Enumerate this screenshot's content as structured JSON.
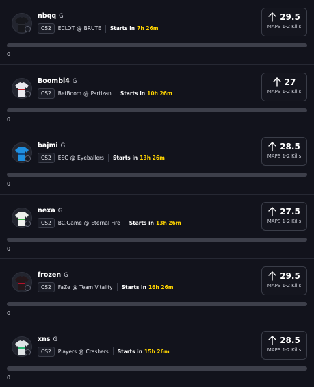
{
  "picks": [
    {
      "player": "nbqq",
      "position": "G",
      "game": "CS2",
      "team": "ECLOT",
      "opponent": "BRUTE",
      "vs": "@",
      "starts_label": "Starts in",
      "starts_time": "7h 26m",
      "line": "29.5",
      "stat": "MAPS 1-2 Kills",
      "progress_value": "0",
      "progress_fraction": 0,
      "jersey_color": "#17181d",
      "jersey_accent": "#2a2c33"
    },
    {
      "player": "Boombl4",
      "position": "G",
      "game": "CS2",
      "team": "BetBoom",
      "opponent": "Partizan",
      "vs": "@",
      "starts_label": "Starts in",
      "starts_time": "10h 26m",
      "line": "27",
      "stat": "MAPS 1-2 Kills",
      "progress_value": "0",
      "progress_fraction": 0,
      "jersey_color": "#e9e9ee",
      "jersey_accent": "#c4242c"
    },
    {
      "player": "bajmi",
      "position": "G",
      "game": "CS2",
      "team": "ESC",
      "opponent": "Eyeballers",
      "vs": "@",
      "starts_label": "Starts in",
      "starts_time": "13h 26m",
      "line": "28.5",
      "stat": "MAPS 1-2 Kills",
      "progress_value": "0",
      "progress_fraction": 0,
      "jersey_color": "#1f8fe0",
      "jersey_accent": "#0e4d8c"
    },
    {
      "player": "nexa",
      "position": "G",
      "game": "CS2",
      "team": "BC.Game",
      "opponent": "Eternal Fire",
      "vs": "@",
      "starts_label": "Starts in",
      "starts_time": "13h 26m",
      "line": "27.5",
      "stat": "MAPS 1-2 Kills",
      "progress_value": "0",
      "progress_fraction": 0,
      "jersey_color": "#eef0ec",
      "jersey_accent": "#3bb54a"
    },
    {
      "player": "frozen",
      "position": "G",
      "game": "CS2",
      "team": "FaZe",
      "opponent": "Team Vitality",
      "vs": "@",
      "starts_label": "Starts in",
      "starts_time": "16h 26m",
      "line": "29.5",
      "stat": "MAPS 1-2 Kills",
      "progress_value": "0",
      "progress_fraction": 0,
      "jersey_color": "#25171b",
      "jersey_accent": "#b3122c"
    },
    {
      "player": "xns",
      "position": "G",
      "game": "CS2",
      "team": "Players",
      "opponent": "Crashers",
      "vs": "@",
      "starts_label": "Starts in",
      "starts_time": "15h 26m",
      "line": "28.5",
      "stat": "MAPS 1-2 Kills",
      "progress_value": "0",
      "progress_fraction": 0,
      "jersey_color": "#dfe4e6",
      "jersey_accent": "#2bb673"
    }
  ],
  "icons": {
    "projection_arrow": "arrow-up-icon",
    "badge": "team-badge-icon"
  },
  "colors": {
    "background": "#12131c",
    "time_highlight": "#ffd400",
    "card_border": "#3a3d48"
  }
}
